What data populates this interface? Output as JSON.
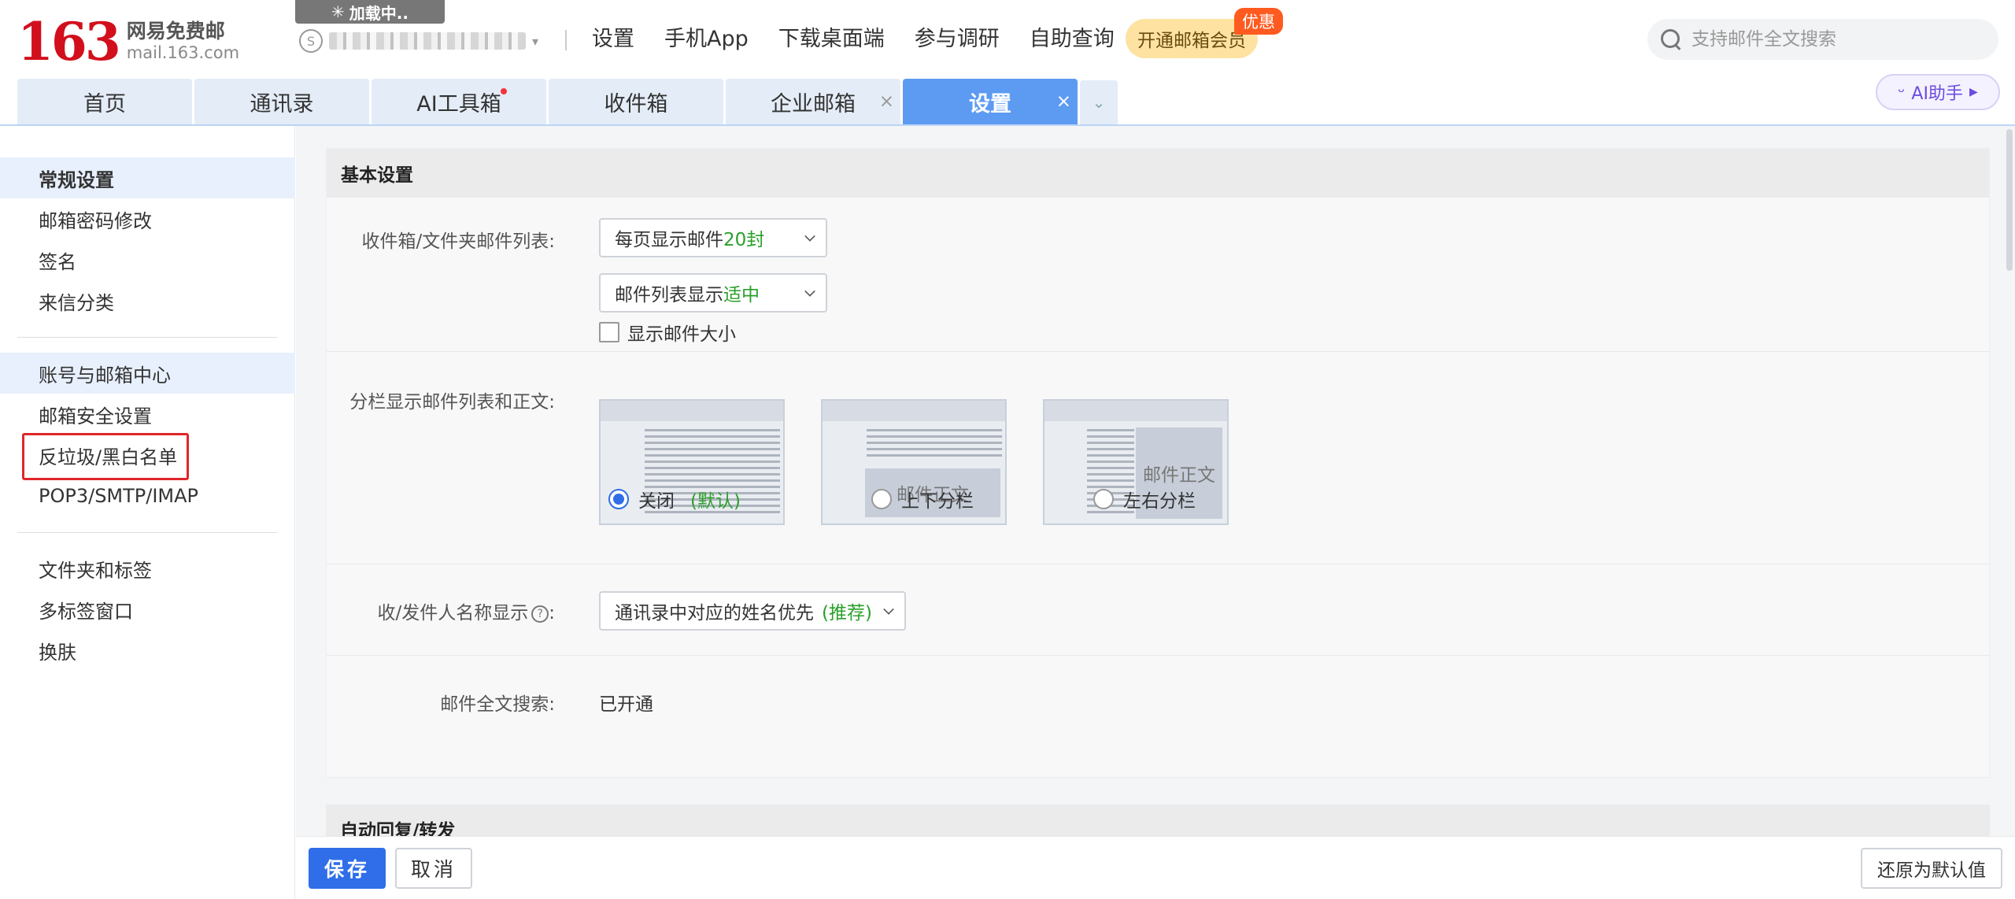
{
  "logo": {
    "number": "163",
    "name": "网易免费邮",
    "domain": "mail.163.com"
  },
  "loading_text": "加载中..",
  "account": {
    "badge_icon": "shield-s-icon"
  },
  "top_nav": [
    "设置",
    "手机App",
    "下载桌面端",
    "参与调研",
    "自助查询"
  ],
  "vip": {
    "label": "开通邮箱会员",
    "tag": "优惠"
  },
  "search": {
    "placeholder": "支持邮件全文搜索"
  },
  "tabs": [
    {
      "label": "首页"
    },
    {
      "label": "通讯录"
    },
    {
      "label": "AI工具箱",
      "dot": true
    },
    {
      "label": "收件箱"
    },
    {
      "label": "企业邮箱",
      "closable": true
    },
    {
      "label": "设置",
      "closable": true,
      "active": true
    }
  ],
  "close_symbol": "×",
  "ai_assistant": {
    "label": "AI助手"
  },
  "sidebar": {
    "groups": [
      [
        "常规设置",
        "邮箱密码修改",
        "签名",
        "来信分类"
      ],
      [
        "账号与邮箱中心",
        "邮箱安全设置",
        "反垃圾/黑白名单",
        "POP3/SMTP/IMAP"
      ],
      [
        "文件夹和标签",
        "多标签窗口",
        "换肤"
      ]
    ]
  },
  "basic": {
    "title": "基本设置",
    "list_label": "收件箱/文件夹邮件列表:",
    "per_page_prefix": "每页显示邮件",
    "per_page_value": "20封",
    "density_prefix": "邮件列表显示",
    "density_value": "适中",
    "show_size_label": "显示邮件大小",
    "split_label": "分栏显示邮件列表和正文:",
    "preview_text": "邮件正文",
    "split_options": [
      {
        "label": "关闭",
        "extra": "(默认)",
        "checked": true
      },
      {
        "label": "上下分栏",
        "checked": false
      },
      {
        "label": "左右分栏",
        "checked": false
      }
    ],
    "name_label": "收/发件人名称显示",
    "name_value": "通讯录中对应的姓名优先",
    "name_extra": "(推荐)",
    "fulltext_label": "邮件全文搜索:",
    "fulltext_value": "已开通"
  },
  "auto_reply": {
    "title": "自动回复/转发"
  },
  "footer": {
    "save": "保存",
    "cancel": "取消",
    "reset": "还原为默认值"
  },
  "colors": {
    "brand_red": "#d20f1c",
    "active_tab": "#5d9bf2",
    "primary": "#2f6ee8",
    "highlight_green": "#2aa02a"
  }
}
